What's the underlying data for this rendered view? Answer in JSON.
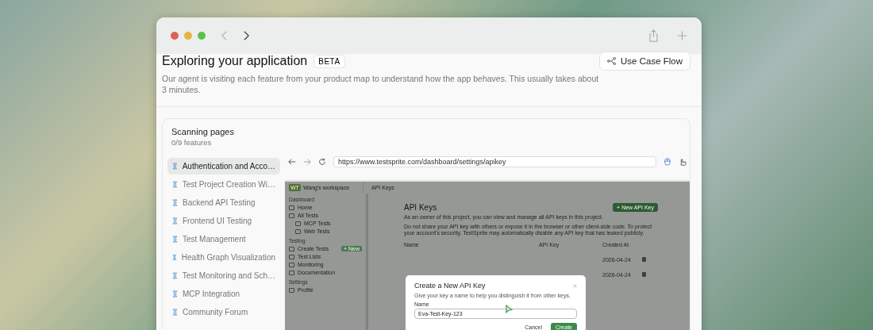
{
  "header": {
    "title": "Exploring your application",
    "badge": "BETA",
    "description": "Our agent is visiting each feature from your product map to understand how the app behaves. This usually takes about 3 minutes.",
    "button": "Use Case Flow"
  },
  "scan": {
    "title": "Scanning pages",
    "count": "0/9 features",
    "features": [
      {
        "label": "Authentication and Acco…",
        "selected": true
      },
      {
        "label": "Test Project Creation Wi…",
        "selected": false
      },
      {
        "label": "Backend API Testing",
        "selected": false
      },
      {
        "label": "Frontend UI Testing",
        "selected": false
      },
      {
        "label": "Test Management",
        "selected": false
      },
      {
        "label": "Health Graph Visualization",
        "selected": false
      },
      {
        "label": "Test Monitoring and Sch…",
        "selected": false
      },
      {
        "label": "MCP Integration",
        "selected": false
      },
      {
        "label": "Community Forum",
        "selected": false
      }
    ]
  },
  "browser": {
    "url": "https://www.testsprite.com/dashboard/settings/apikey",
    "page": {
      "avatar": "WT",
      "workspace": "Wang's workspace",
      "breadcrumb": "API Keys",
      "nav": [
        {
          "kind": "section",
          "label": "Dashboard"
        },
        {
          "kind": "item",
          "label": "Home"
        },
        {
          "kind": "item",
          "label": "All Tests"
        },
        {
          "kind": "subitem",
          "label": "MCP Tests"
        },
        {
          "kind": "subitem",
          "label": "Web Tests"
        },
        {
          "kind": "section",
          "label": "Testing"
        },
        {
          "kind": "item",
          "label": "Create Tests",
          "badge": "+ New"
        },
        {
          "kind": "item",
          "label": "Test Lists"
        },
        {
          "kind": "item",
          "label": "Monitoring"
        },
        {
          "kind": "item",
          "label": "Documentation"
        },
        {
          "kind": "section",
          "label": "Settings"
        },
        {
          "kind": "item",
          "label": "Profile"
        }
      ],
      "heading": "API Keys",
      "new_button": "+ New API Key",
      "intro": [
        "As an owner of this project, you can view and manage all API keys in this project.",
        "Do not share your API key with others or expose it in the browser or other client-side code. To protect your account's security, TestSprite may automatically disable any API key that has leaked publicly."
      ],
      "columns": [
        "Name",
        "API Key",
        "Created At"
      ],
      "rows": [
        {
          "created": "2026-04-24"
        },
        {
          "created": "2026-04-24"
        }
      ],
      "dialog": {
        "title": "Create a New API Key",
        "subtitle": "Give your key a name to help you distinguish it from other keys.",
        "label": "Name",
        "value": "Eva-Test-Key-123",
        "cancel": "Cancel",
        "create": "Create"
      }
    }
  }
}
